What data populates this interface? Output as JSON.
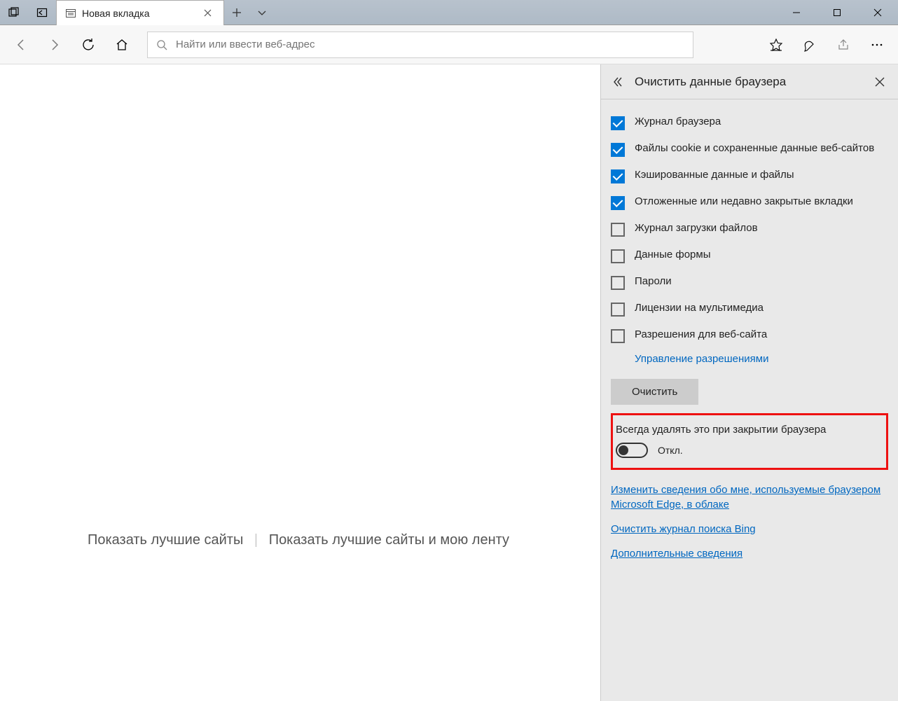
{
  "tab": {
    "title": "Новая вкладка"
  },
  "addressbar": {
    "placeholder": "Найти или ввести веб-адрес"
  },
  "start": {
    "show_top_sites": "Показать лучшие сайты",
    "show_top_sites_feed": "Показать лучшие сайты и мою ленту"
  },
  "panel": {
    "title": "Очистить данные браузера",
    "checks": [
      {
        "label": "Журнал браузера",
        "checked": true
      },
      {
        "label": "Файлы cookie и сохраненные данные веб-сайтов",
        "checked": true
      },
      {
        "label": "Кэшированные данные и файлы",
        "checked": true
      },
      {
        "label": "Отложенные или недавно закрытые вкладки",
        "checked": true
      },
      {
        "label": "Журнал загрузки файлов",
        "checked": false
      },
      {
        "label": "Данные формы",
        "checked": false
      },
      {
        "label": "Пароли",
        "checked": false
      },
      {
        "label": "Лицензии на мультимедиа",
        "checked": false
      },
      {
        "label": "Разрешения для веб-сайта",
        "checked": false
      }
    ],
    "manage_permissions": "Управление разрешениями",
    "clear_button": "Очистить",
    "always_clear_label": "Всегда удалять это при закрытии браузера",
    "toggle_state": "Откл.",
    "links": {
      "cloud": "Изменить сведения обо мне, используемые браузером Microsoft Edge, в облаке",
      "bing": "Очистить журнал поиска Bing",
      "more": "Дополнительные сведения"
    }
  }
}
